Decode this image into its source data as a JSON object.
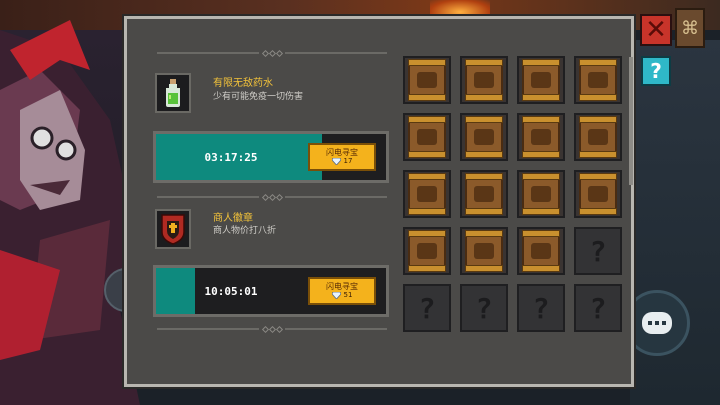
{
  "items": [
    {
      "name": "有限无敌药水",
      "description": "少有可能免疫一切伤害",
      "timer": "03:17:25",
      "progress": 0.72,
      "button_label": "闪电寻宝",
      "cost": "17",
      "icon": "potion-icon"
    },
    {
      "name": "商人徽章",
      "description": "商人物价打八折",
      "timer": "10:05:01",
      "progress": 0.17,
      "button_label": "闪电寻宝",
      "cost": "51",
      "icon": "merchant-badge-icon"
    }
  ],
  "grid": {
    "rows": 5,
    "cols": 4,
    "slots": [
      "unlocked",
      "unlocked",
      "unlocked",
      "unlocked",
      "unlocked",
      "unlocked",
      "unlocked",
      "unlocked",
      "unlocked",
      "unlocked",
      "unlocked",
      "unlocked",
      "unlocked",
      "unlocked",
      "unlocked",
      "locked",
      "locked",
      "locked",
      "locked",
      "locked"
    ],
    "locked_symbol": "?"
  },
  "buttons": {
    "close_symbol": "✕",
    "help_symbol": "?"
  },
  "colors": {
    "timer_fill": "#0e8a7e",
    "item_name": "#f2c23a",
    "flash_button": "#f4b21c",
    "close_button": "#c8342a",
    "help_button": "#2fb8c8"
  }
}
